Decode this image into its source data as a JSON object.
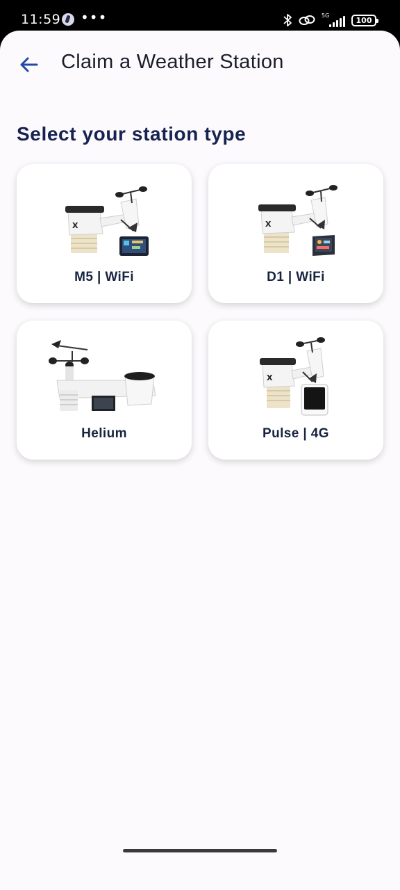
{
  "status_bar": {
    "time": "11:59",
    "overflow": "•••",
    "network": "5G",
    "battery": "100"
  },
  "header": {
    "title": "Claim a Weather Station",
    "back_icon": "arrow-left-icon"
  },
  "section": {
    "heading": "Select your station type"
  },
  "station_types": [
    {
      "label": "M5 | WiFi"
    },
    {
      "label": "D1 | WiFi"
    },
    {
      "label": "Helium"
    },
    {
      "label": "Pulse | 4G"
    }
  ],
  "colors": {
    "background": "#fcfafd",
    "heading": "#162350",
    "back_arrow": "#1f4aa5",
    "card": "#ffffff"
  }
}
